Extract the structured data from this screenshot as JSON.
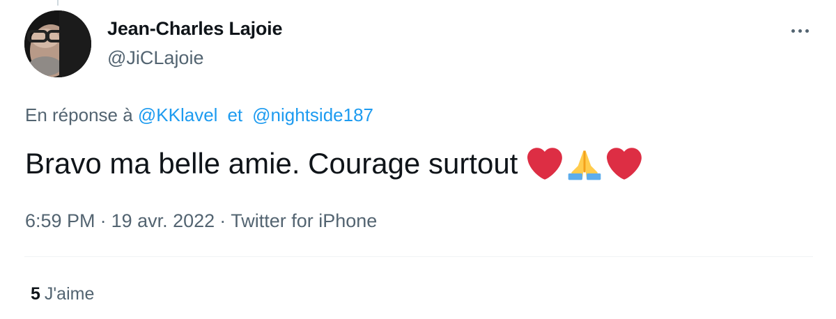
{
  "author": {
    "display_name": "Jean-Charles Lajoie",
    "handle": "@JiCLajoie"
  },
  "reply": {
    "prefix": "En réponse à",
    "users": [
      "@KKlavel",
      "@nightside187"
    ],
    "separator": "et"
  },
  "tweet": {
    "text": "Bravo ma belle amie. Courage surtout",
    "emojis": [
      "red-heart-icon",
      "folded-hands-icon",
      "red-heart-icon"
    ]
  },
  "meta": {
    "time": "6:59 PM",
    "date": "19 avr. 2022",
    "source": "Twitter for iPhone",
    "separator": "·"
  },
  "stats": {
    "likes_count": "5",
    "likes_label": "J'aime"
  },
  "colors": {
    "link": "#1d9bf0",
    "secondary_text": "#536471",
    "primary_text": "#0f1419",
    "heart": "#dd2e44",
    "hands": "#ffcc4d"
  }
}
